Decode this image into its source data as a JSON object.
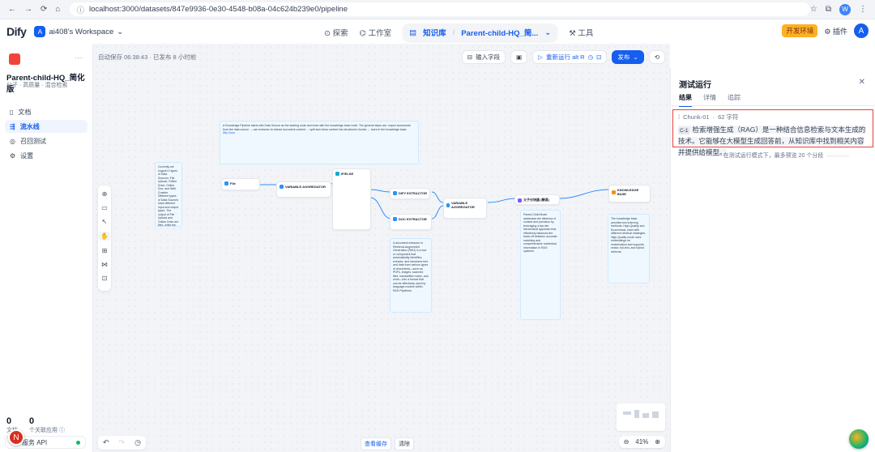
{
  "browser": {
    "url": "localhost:3000/datasets/847e9936-0e30-4548-b08a-04c624b239e0/pipeline",
    "profile": "W"
  },
  "header": {
    "logo": "Dify",
    "workspace_badge": "A",
    "workspace": "ai408's Workspace",
    "nav": {
      "explore": "探索",
      "studio": "工作室",
      "knowledge": "知识库",
      "current_kb": "Parent-child-HQ_简...",
      "tools": "工具"
    },
    "env_badge": "开发环境",
    "plugins": "插件",
    "avatar": "A"
  },
  "sidebar": {
    "kb_name": "Parent-child-HQ_简化版",
    "kb_sub": "父子 · 高质量 · 混合检索",
    "items": [
      {
        "label": "文档",
        "icon": "document-icon"
      },
      {
        "label": "流水线",
        "icon": "pipeline-icon"
      },
      {
        "label": "召回测试",
        "icon": "target-icon"
      },
      {
        "label": "设置",
        "icon": "settings-icon"
      }
    ],
    "stats": [
      {
        "value": "0",
        "label": "文档"
      },
      {
        "value": "0",
        "label": "个关联应用 ⓘ"
      }
    ],
    "api_label": "服务 API",
    "notion_badge": "N"
  },
  "canvas": {
    "autosave": "自动保存 06:38:43 · 已发布 8 小时前",
    "toolbar": {
      "input_field": "输入字段",
      "rerun": "重新运行 alt R",
      "publish": "发布"
    },
    "bottom": {
      "view_cache": "查看缓存",
      "clear": "清除"
    },
    "zoom": "41%",
    "nodes": {
      "file": "File",
      "var_agg_1": "VARIABLE AGGREGATOR",
      "if_else": "IF/ELSE",
      "dify_extractor": "DIFY EXTRACTOR",
      "doc_extractor": "DOC EXTRACTOR",
      "var_agg_2": "VARIABLE AGGREGATOR",
      "chunker": "父子分块器 (精读)",
      "knowledge_base": "KNOWLEDGE BASE"
    },
    "notes": {
      "top": "A Knowledge Pipeline starts with Data Source as the starting node and ends with the knowledge base node. The general steps are: import documents from the data source → use extractor to extract document content → split and clean content into structured chunks → store in the knowledge base.",
      "top_link": "Dify Docs",
      "left": "Currently we support 4 types of Data Sources: File Upload, Online Drive, Online Doc, and Web Crawler. Different types of Data Sources have different input and output types. The output of File Upload and Online Drive are files, while the output of Online Doc and Web Crawler are pages. You can find more Data Sources on our Marketplace.",
      "mid": "A document extractor in Retrieval-Augmented Generation (RAG) is a tool or component that automatically identifies, extracts, and structures text and data from various types of documents—such as PDFs, images, scanned files, handwritten notes, and more—into a format that can be effectively used by language models within RAG Pipelines.",
      "chunker": "Parent-Child Mode addresses the dilemma of context and precision by leveraging a two-tier hierarchical approach that effectively balances the trade-off between accurate matching and comprehensive contextual information in RAG systems.",
      "kb": "The knowledge base provides two indexing methods: High-Quality and Economical, each with different retrieval strategies. High-Quality mode uses embeddings for vectorization and supports vector, full-text, and hybrid retrieval."
    }
  },
  "panel": {
    "title": "测试运行",
    "tabs": [
      "结果",
      "详情",
      "追踪"
    ],
    "chunk_id": "Chunk-01",
    "chunk_chars": "62 字符",
    "chunk_tag": "C-1",
    "chunk_text": "检索增强生成（RAG）是一种结合信息检索与文本生成的技术。它能够在大模型生成回答前，从知识库中找到相关内容并提供给模型。",
    "preview_note": "在测试运行模式下，最多预览 20 个分段"
  },
  "colors": {
    "brand": "#155eef",
    "highlight_border": "#e5433a",
    "env_badge": "#fdb022"
  }
}
